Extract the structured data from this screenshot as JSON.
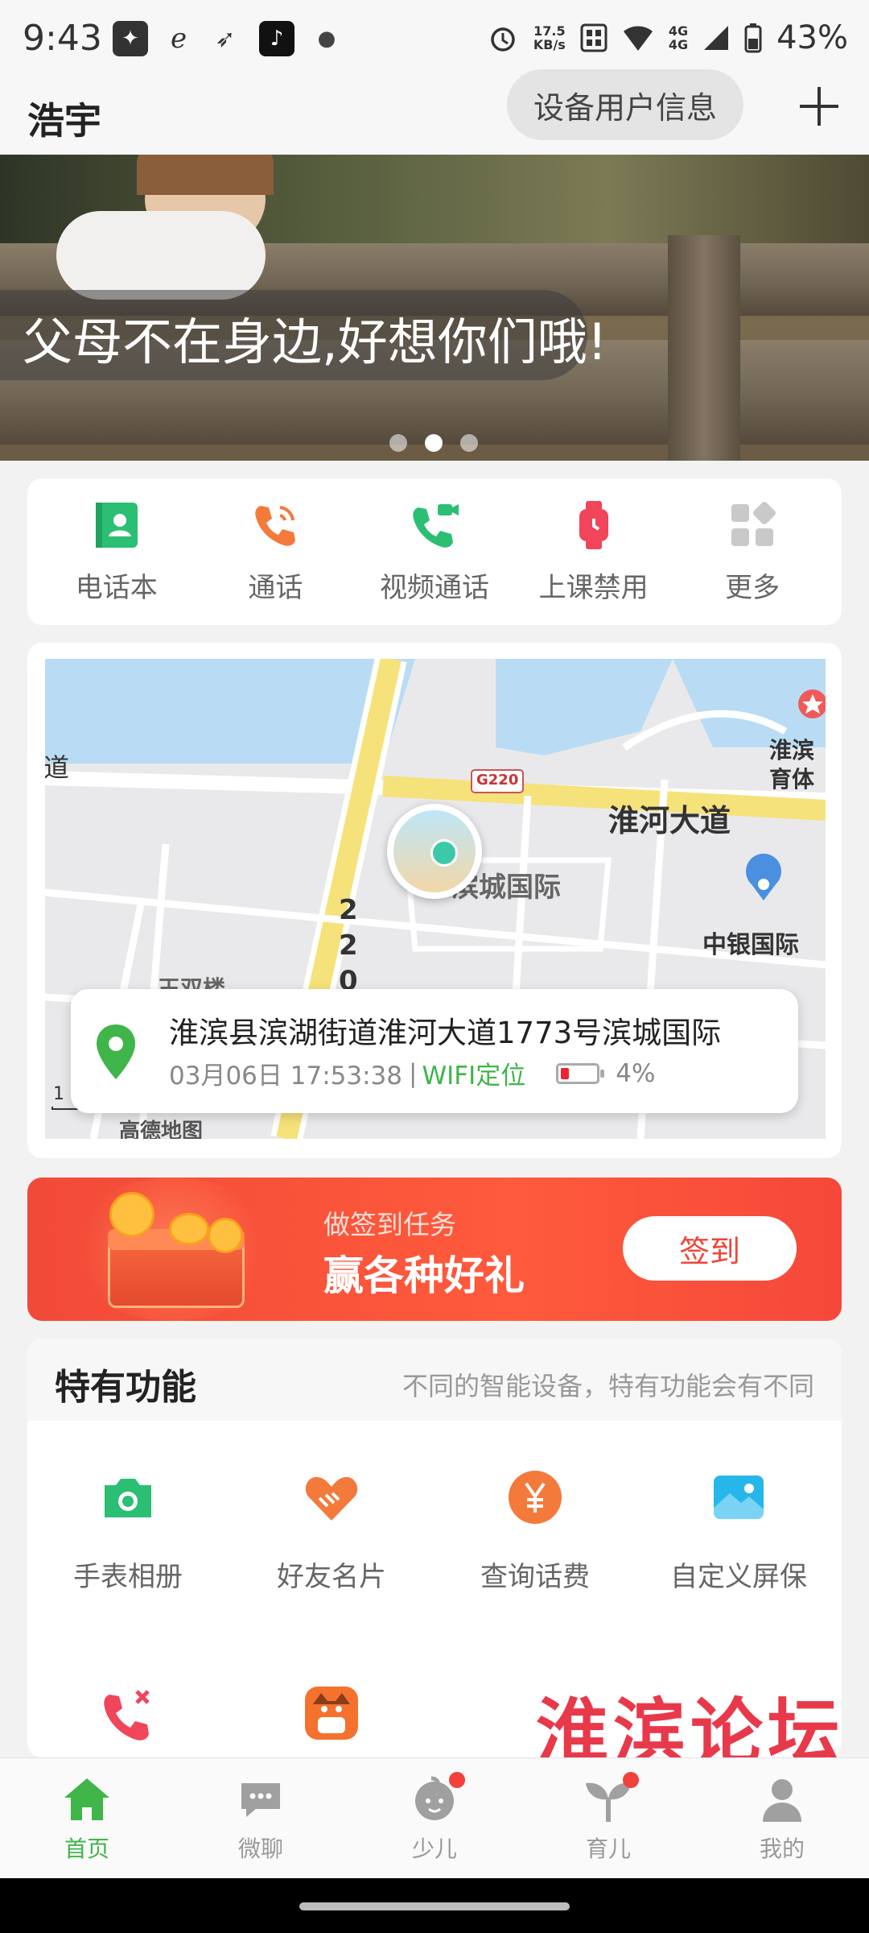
{
  "status_bar": {
    "time": "9:43",
    "speed": "17.5",
    "speed_unit": "KB/s",
    "network": "4G",
    "battery": "43%"
  },
  "header": {
    "title": "浩宇",
    "device_info_button": "设备用户信息"
  },
  "banner": {
    "caption": "父母不在身边,好想你们哦!",
    "slide_count": 3,
    "active_slide": 2
  },
  "quick_actions": [
    {
      "label": "电话本",
      "icon": "contact-book-icon",
      "color": "#2bbf73"
    },
    {
      "label": "通话",
      "icon": "phone-call-icon",
      "color": "#f47a3c"
    },
    {
      "label": "视频通话",
      "icon": "video-call-icon",
      "color": "#2bbf73"
    },
    {
      "label": "上课禁用",
      "icon": "watch-icon",
      "color": "#f0455a"
    },
    {
      "label": "更多",
      "icon": "more-grid-icon",
      "color": "#c9c9c9"
    }
  ],
  "map": {
    "labels": {
      "road_main": "淮河大道",
      "road_left": "道",
      "road_code": "G220",
      "road_vertical": "220",
      "poi_home": "滨城国际",
      "poi_bank": "中银国际",
      "poi_sport_1": "淮滨",
      "poi_sport_2": "育体",
      "poi_bottom_left": "王双楼",
      "scale": "1",
      "brand": "高德地图"
    },
    "location": {
      "address": "淮滨县滨湖街道淮河大道1773号滨城国际",
      "datetime": "03月06日 17:53:38",
      "separator": "|",
      "method": "WIFI定位",
      "battery": "4%",
      "battery_level": 0.04
    }
  },
  "checkin": {
    "subtitle": "做签到任务",
    "title": "赢各种好礼",
    "button": "签到"
  },
  "special": {
    "title": "特有功能",
    "subtitle": "不同的智能设备，特有功能会有不同",
    "items": [
      {
        "label": "手表相册",
        "icon": "camera-icon",
        "color": "#2bbf73"
      },
      {
        "label": "好友名片",
        "icon": "handshake-icon",
        "color": "#f47a3c"
      },
      {
        "label": "查询话费",
        "icon": "yuan-icon",
        "color": "#f47a3c"
      },
      {
        "label": "自定义屏保",
        "icon": "picture-icon",
        "color": "#27b6ea"
      },
      {
        "label": "",
        "icon": "call-block-icon",
        "color": "#f0455a"
      },
      {
        "label": "",
        "icon": "listen-app-icon",
        "color": "#f5722e"
      }
    ],
    "watermark": "淮滨论坛"
  },
  "bottom_nav": [
    {
      "label": "首页",
      "icon": "home-icon",
      "active": true,
      "badge": false
    },
    {
      "label": "微聊",
      "icon": "chat-icon",
      "active": false,
      "badge": false
    },
    {
      "label": "少儿",
      "icon": "kid-icon",
      "active": false,
      "badge": true
    },
    {
      "label": "育儿",
      "icon": "sprout-icon",
      "active": false,
      "badge": true
    },
    {
      "label": "我的",
      "icon": "profile-icon",
      "active": false,
      "badge": false
    }
  ],
  "colors": {
    "accent_green": "#3fb54a",
    "checkin_red": "#f24a38"
  }
}
